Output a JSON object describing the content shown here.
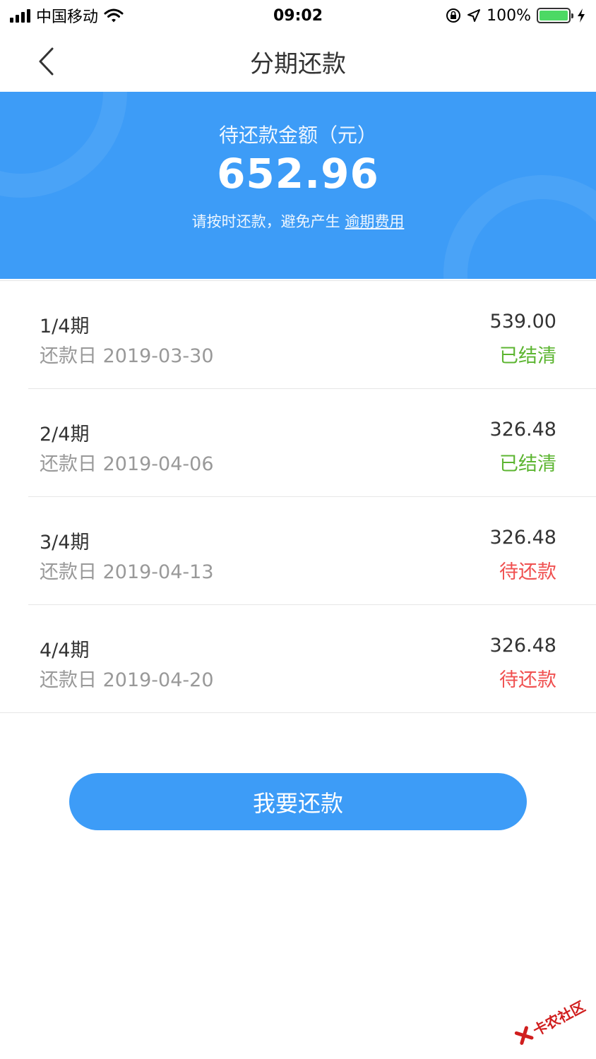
{
  "status_bar": {
    "carrier": "中国移动",
    "time": "09:02",
    "battery": "100%"
  },
  "nav": {
    "title": "分期还款"
  },
  "summary": {
    "label": "待还款金额（元）",
    "amount": "652.96",
    "note": "请按时还款，避免产生",
    "note_link": "逾期费用"
  },
  "installments": [
    {
      "period": "1/4期",
      "due_date": "还款日 2019-03-30",
      "amount": "539.00",
      "status": "已结清"
    },
    {
      "period": "2/4期",
      "due_date": "还款日 2019-04-06",
      "amount": "326.48",
      "status": "已结清"
    },
    {
      "period": "3/4期",
      "due_date": "还款日 2019-04-13",
      "amount": "326.48",
      "status": "待还款"
    },
    {
      "period": "4/4期",
      "due_date": "还款日 2019-04-20",
      "amount": "326.48",
      "status": "待还款"
    }
  ],
  "actions": {
    "pay_label": "我要还款"
  },
  "watermark": {
    "text": "卡农社区"
  },
  "colors": {
    "primary": "#3d9cf7",
    "settled": "#5cb531",
    "pending": "#f05050"
  }
}
